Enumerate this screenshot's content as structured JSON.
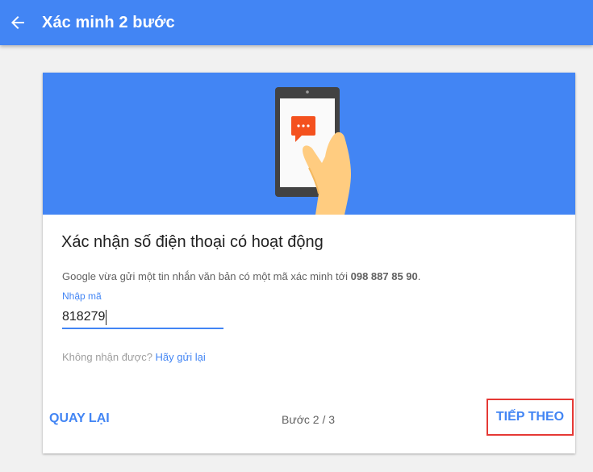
{
  "appbar": {
    "title": "Xác minh 2 bước",
    "back_icon": "arrow-back-icon"
  },
  "hero": {
    "illustration": "phone-message-icon",
    "phone_screen_icon": "chat-bubble-icon"
  },
  "card": {
    "title": "Xác nhận số điện thoại có hoạt động",
    "description_prefix": "Google vừa gửi một tin nhắn văn bản có một mã xác minh tới ",
    "phone_number": "098 887 85 90",
    "description_suffix": ".",
    "code_label": "Nhập mã",
    "code_value": "818279",
    "resend_prefix": "Không nhận được? ",
    "resend_link": "Hãy gửi lại"
  },
  "footer": {
    "back_label": "QUAY LẠI",
    "step_text": "Bước 2 / 3",
    "next_label": "TIẾP THEO"
  },
  "colors": {
    "primary": "#4285f4",
    "highlight_border": "#e53935",
    "message_bubble": "#f4511e"
  }
}
